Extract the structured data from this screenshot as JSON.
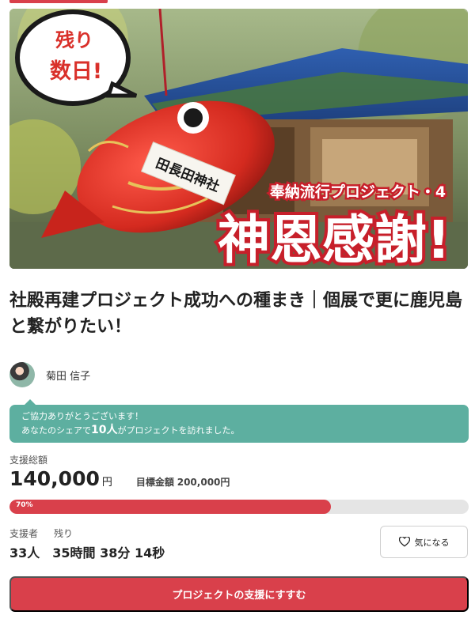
{
  "hero": {
    "badge_line1": "残り",
    "badge_line2": "数日!",
    "project_series": "奉納流行プロジェクト・4",
    "main_slogan": "神恩感謝!",
    "tag_text": "田長田神社"
  },
  "project": {
    "title": "社殿再建プロジェクト成功への種まき｜個展で更に鹿児島と繋がりたい！"
  },
  "owner": {
    "name": "菊田 信子"
  },
  "share": {
    "line1": "ご協力ありがとうございます！",
    "line2_prefix": "あなたのシェアで",
    "line2_count": "10人",
    "line2_suffix": "がプロジェクトを訪れました。"
  },
  "funding": {
    "total_label": "支援総額",
    "amount": "140,000",
    "currency": "円",
    "goal_label": "目標金額",
    "goal_amount": "200,000円",
    "progress": 0.7,
    "progress_text": "70%"
  },
  "stats": {
    "supporters_label": "支援者",
    "remaining_label": "残り",
    "supporters_value": "33人",
    "remaining_value": "35時間 38分 14秒"
  },
  "actions": {
    "favorite_label": "気になる",
    "support_label": "プロジェクトの支援にすすむ"
  },
  "colors": {
    "accent": "#d9404b",
    "share_bg": "#5dafa0",
    "track": "#e5e5e5"
  }
}
